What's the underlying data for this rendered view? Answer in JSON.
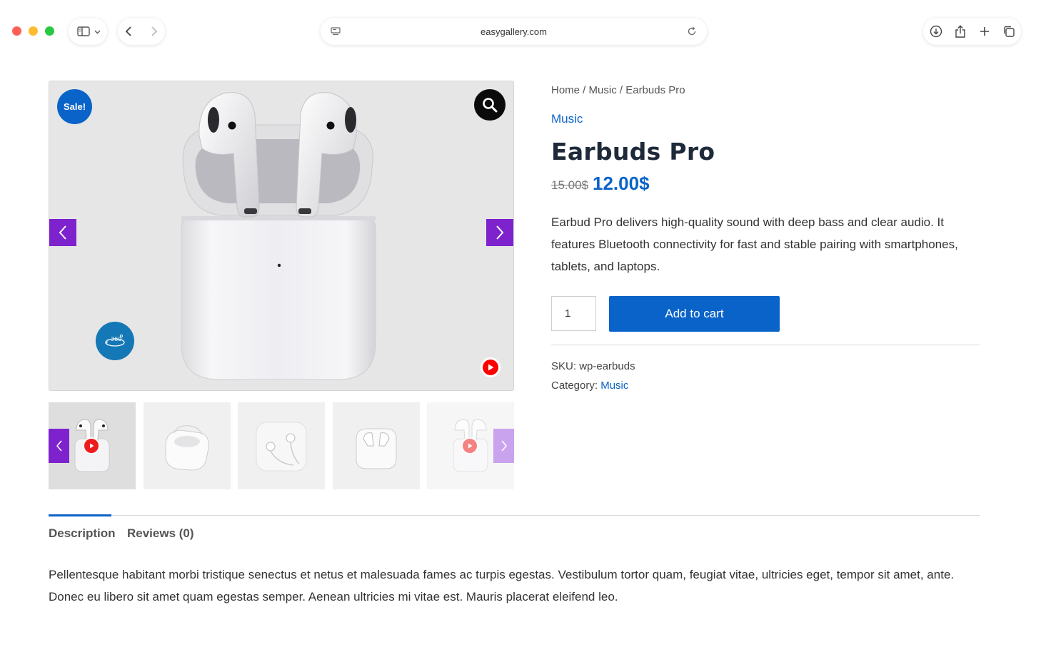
{
  "browser": {
    "url": "easygallery.com"
  },
  "gallery": {
    "sale_badge": "Sale!",
    "thumbnails": [
      {
        "id": "thumb-1",
        "has_video": true,
        "active": true
      },
      {
        "id": "thumb-2",
        "has_video": false,
        "active": false
      },
      {
        "id": "thumb-3",
        "has_video": false,
        "active": false
      },
      {
        "id": "thumb-4",
        "has_video": false,
        "active": false
      },
      {
        "id": "thumb-5",
        "has_video": true,
        "active": false
      }
    ]
  },
  "product": {
    "breadcrumb": [
      "Home",
      "Music",
      "Earbuds Pro"
    ],
    "breadcrumb_sep": " / ",
    "category": "Music",
    "title": "Earbuds Pro",
    "price_old": "15.00$",
    "price_new": "12.00$",
    "description": "Earbud Pro delivers high-quality sound with deep bass and clear audio. It features Bluetooth connectivity for fast and stable pairing with smartphones, tablets, and laptops.",
    "quantity": "1",
    "add_to_cart": "Add to cart",
    "sku_label": "SKU:",
    "sku_value": "wp-earbuds",
    "category_label": "Category:",
    "category_value": "Music"
  },
  "tabs": {
    "items": [
      "Description",
      "Reviews (0)"
    ],
    "active": 0,
    "content": "Pellentesque habitant morbi tristique senectus et netus et malesuada fames ac turpis egestas. Vestibulum tortor quam, feugiat vitae, ultricies eget, tempor sit amet, ante. Donec eu libero sit amet quam egestas semper. Aenean ultricies mi vitae est. Mauris placerat eleifend leo."
  },
  "colors": {
    "brand_blue": "#0a63c9",
    "slider_purple": "#7e22ce",
    "badge_360": "#1477b6"
  }
}
